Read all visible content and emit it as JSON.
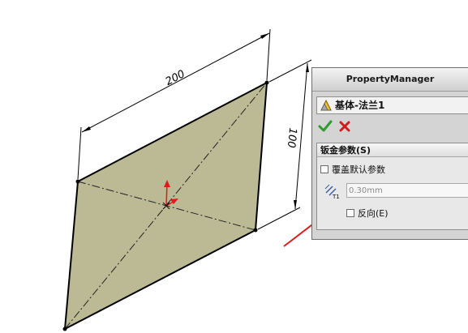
{
  "drawing": {
    "dimension_width": "200",
    "dimension_height": "100",
    "face_color": "#bcb995",
    "annotation_color": "#e0191b"
  },
  "property_manager": {
    "title": "PropertyManager",
    "feature_name": "基体-法兰1",
    "ok_icon": "green-checkmark-icon",
    "cancel_icon": "red-x-icon",
    "group": {
      "title": "钣金参数(S)",
      "override_default_label": "覆盖默认参数",
      "override_default_checked": false,
      "thickness_value": "0.30mm",
      "thickness_icon_label": "T1",
      "reverse_label": "反向(E)",
      "reverse_checked": false
    }
  }
}
